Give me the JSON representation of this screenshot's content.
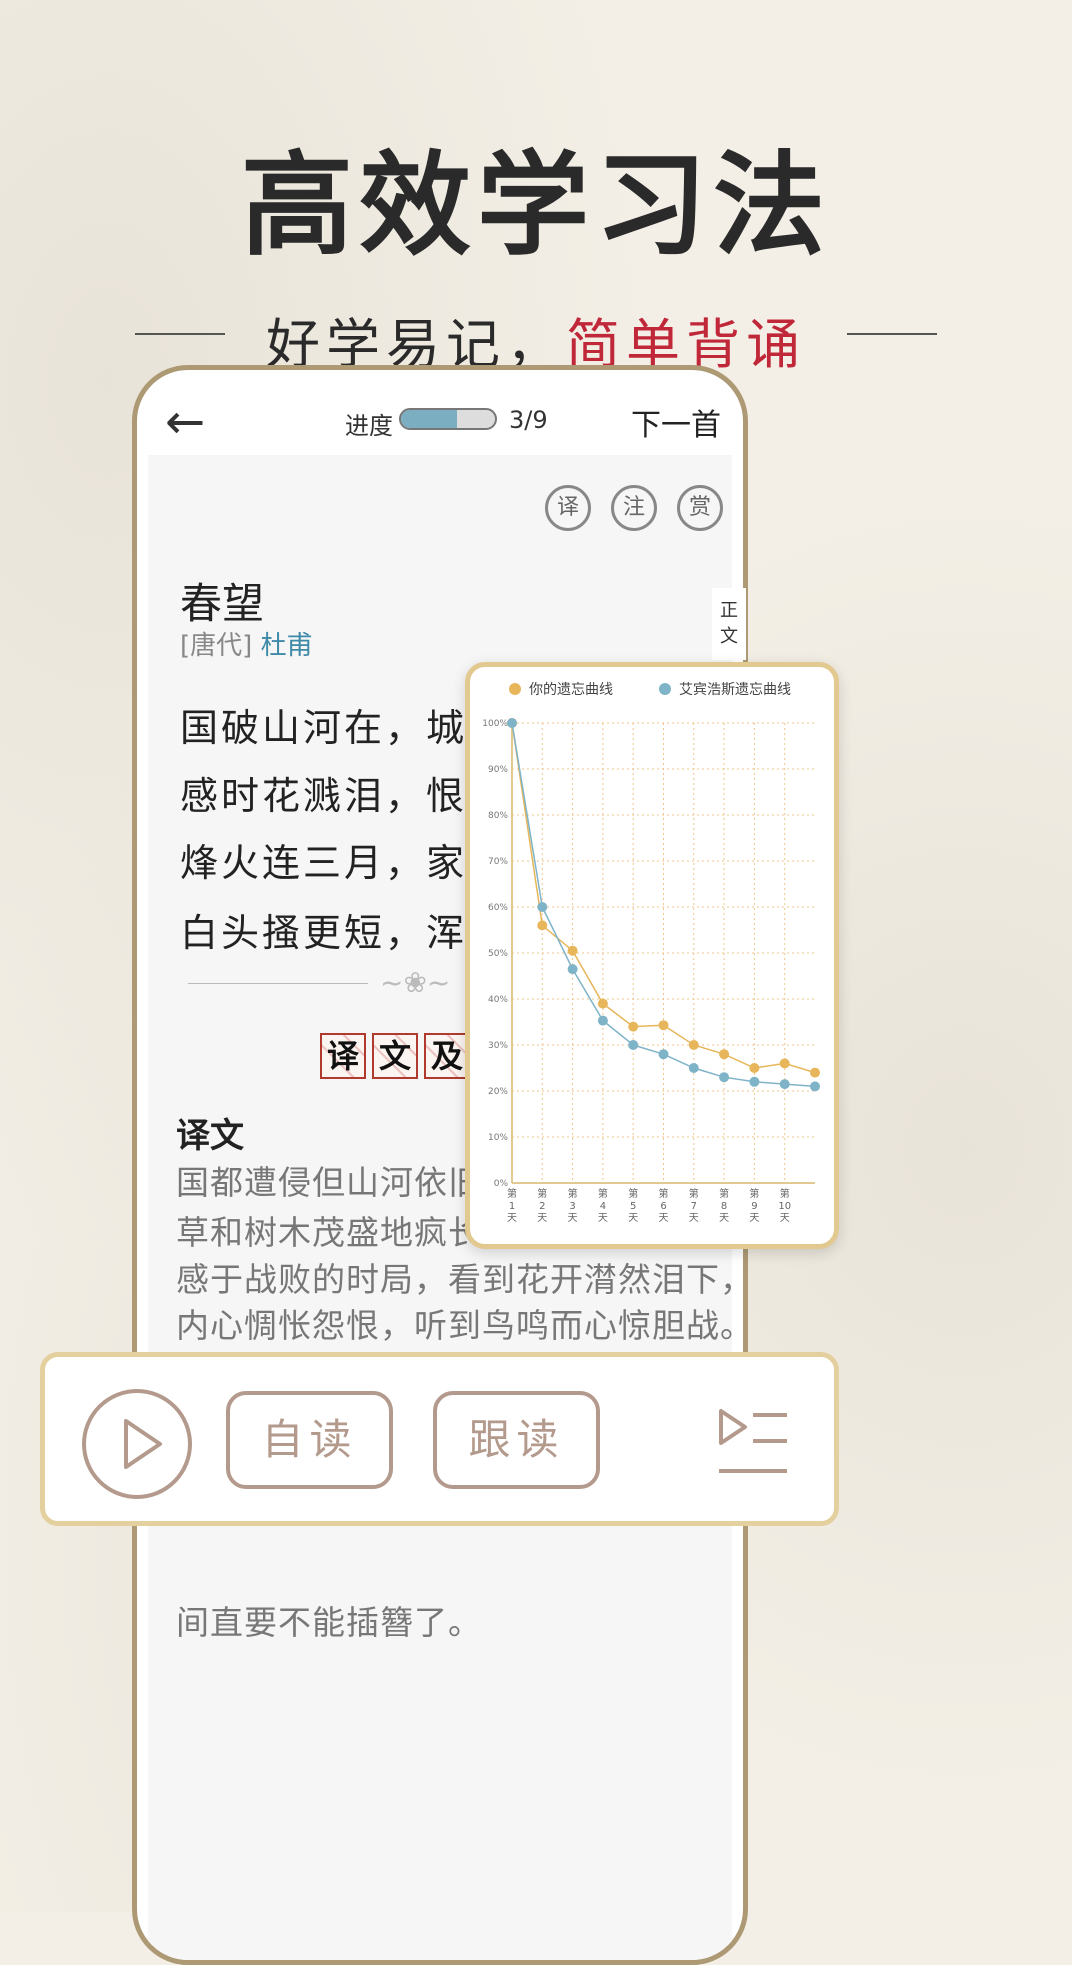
{
  "headline": "高效学习法",
  "subtitle": {
    "part1": "好学易记，",
    "part2": "简单背诵",
    "accent_color": "#c0283a"
  },
  "header": {
    "back_icon": "arrow-left-icon",
    "progress_label": "进度",
    "progress_fill": 0.6,
    "progress_count": "3/9",
    "next_label": "下一首"
  },
  "tools": [
    "译",
    "注",
    "赏"
  ],
  "side_tab": {
    "line1": "正",
    "line2": "文"
  },
  "poem": {
    "title": "春望",
    "dynasty": "[唐代]",
    "author": "杜甫",
    "lines": [
      "国破山河在，城春",
      "感时花溅泪，恨别",
      "烽火连三月，家书",
      "白头搔更短，浑欲"
    ]
  },
  "section_button": [
    "译",
    "文",
    "及"
  ],
  "translation": {
    "title": "译文",
    "lines": [
      "国都遭侵但山河依旧",
      "草和树木茂盛地疯长",
      "感于战败的时局，看到花开潸然泪下，",
      "内心惆怅怨恨，听到鸟鸣而心惊胆战。",
      "间直要不能插簪了。"
    ]
  },
  "bottom_bar": {
    "play_icon": "play-icon",
    "self_read": "自读",
    "follow_read": "跟读",
    "playlist_icon": "playlist-icon"
  },
  "chart_data": {
    "type": "line",
    "legend_position": "top",
    "grid": true,
    "ylim": [
      0,
      100
    ],
    "y_ticks": [
      "0%",
      "10%",
      "20%",
      "30%",
      "40%",
      "50%",
      "60%",
      "70%",
      "80%",
      "90%",
      "100%"
    ],
    "categories": [
      "第1天",
      "第2天",
      "第3天",
      "第4天",
      "第5天",
      "第6天",
      "第7天",
      "第8天",
      "第9天",
      "第10天"
    ],
    "series": [
      {
        "name": "你的遗忘曲线",
        "color": "#e8b65a",
        "values": [
          100,
          56,
          50.5,
          39,
          34,
          34.3,
          30,
          28,
          25,
          26,
          24
        ]
      },
      {
        "name": "艾宾浩斯遗忘曲线",
        "color": "#7fb3c8",
        "values": [
          100,
          60,
          46.5,
          35.3,
          30,
          28,
          25,
          23,
          22,
          21.5,
          21
        ]
      }
    ]
  }
}
